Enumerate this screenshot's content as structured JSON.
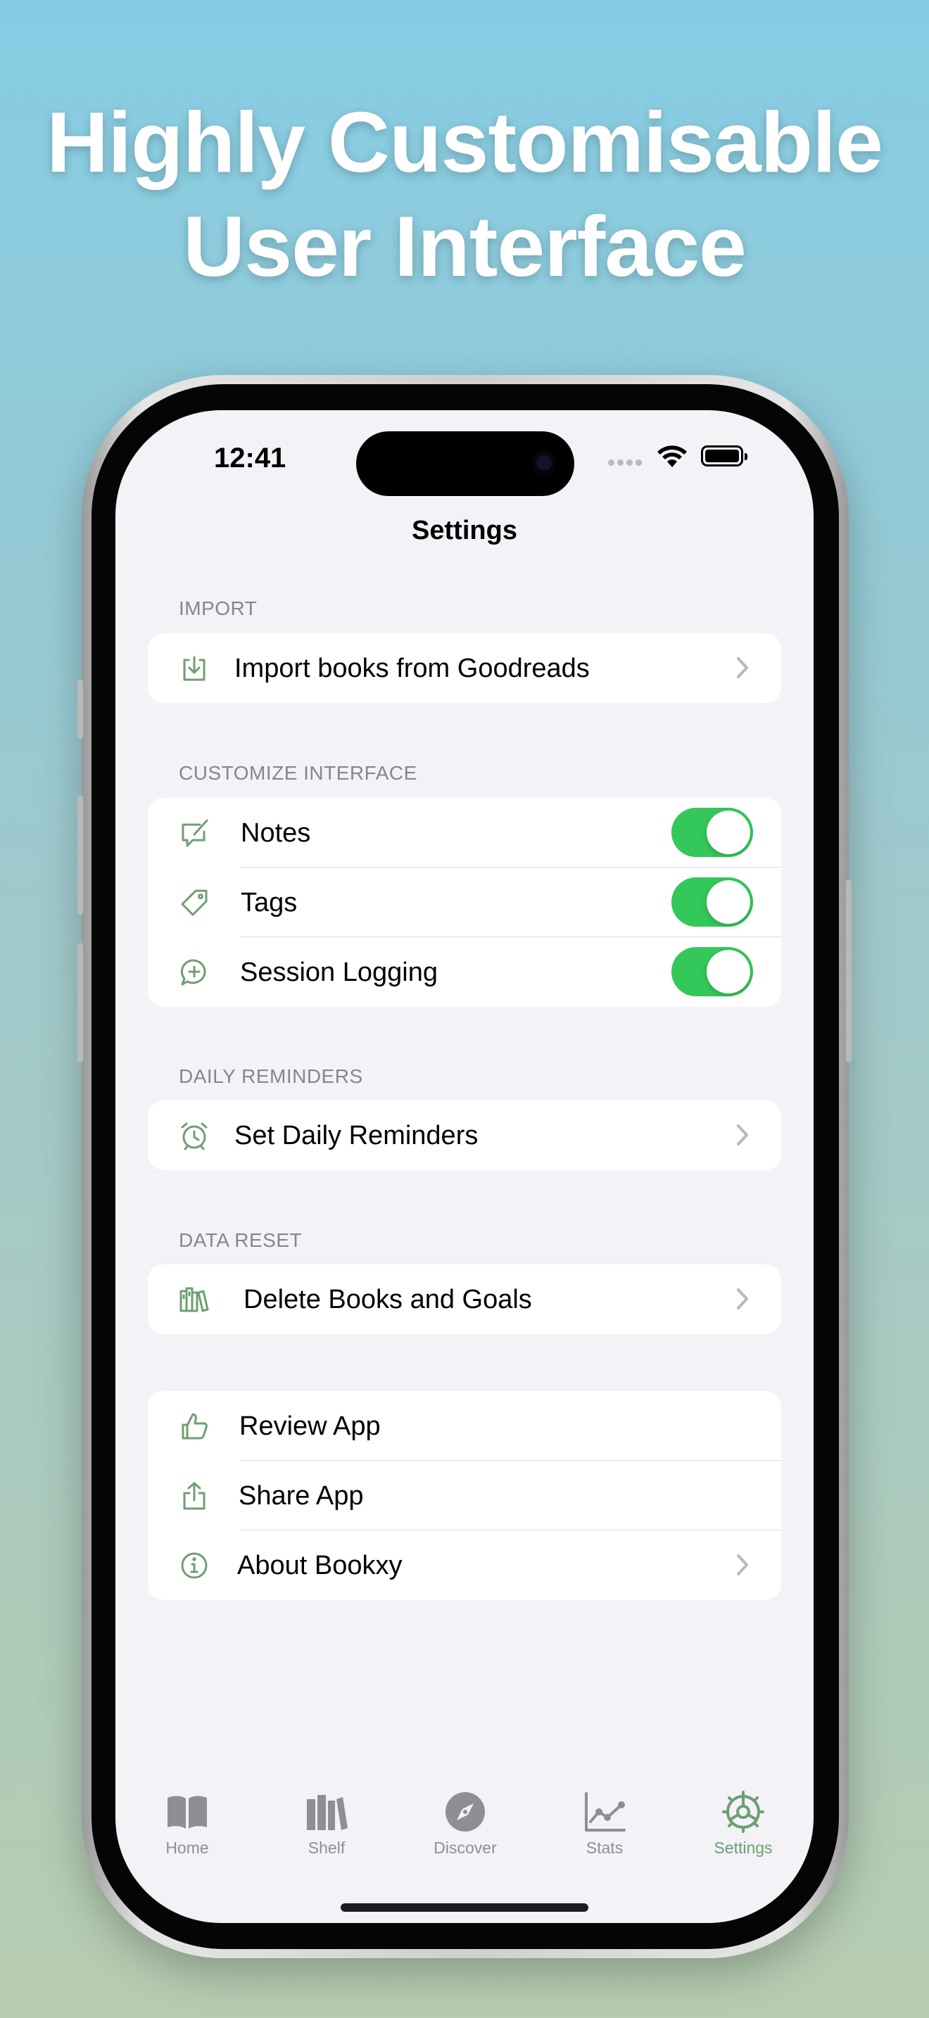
{
  "headline": {
    "line1": "Highly Customisable",
    "line2": "User Interface"
  },
  "status_bar": {
    "time": "12:41"
  },
  "nav": {
    "title": "Settings"
  },
  "colors": {
    "accent": "#6f9e72",
    "toggle_on": "#34c759",
    "background": "#f2f2f7"
  },
  "sections": {
    "import": {
      "header": "IMPORT",
      "rows": [
        {
          "label": "Import books from Goodreads",
          "icon": "import-icon",
          "chevron": true
        }
      ]
    },
    "customize": {
      "header": "CUSTOMIZE INTERFACE",
      "rows": [
        {
          "label": "Notes",
          "icon": "notes-icon",
          "toggle_on": true
        },
        {
          "label": "Tags",
          "icon": "tag-icon",
          "toggle_on": true
        },
        {
          "label": "Session Logging",
          "icon": "session-log-icon",
          "toggle_on": true
        }
      ]
    },
    "reminders": {
      "header": "DAILY REMINDERS",
      "rows": [
        {
          "label": "Set Daily Reminders",
          "icon": "alarm-clock-icon",
          "chevron": true
        }
      ]
    },
    "reset": {
      "header": "DATA RESET",
      "rows": [
        {
          "label": "Delete Books and Goals",
          "icon": "books-icon",
          "chevron": true
        }
      ]
    },
    "about": {
      "rows": [
        {
          "label": "Review App",
          "icon": "thumbs-up-icon"
        },
        {
          "label": "Share App",
          "icon": "share-icon"
        },
        {
          "label": "About Bookxy",
          "icon": "info-icon",
          "chevron": true
        }
      ]
    }
  },
  "tabbar": {
    "tabs": [
      {
        "label": "Home",
        "icon": "book-open-icon"
      },
      {
        "label": "Shelf",
        "icon": "shelf-icon"
      },
      {
        "label": "Discover",
        "icon": "compass-icon"
      },
      {
        "label": "Stats",
        "icon": "chart-icon"
      },
      {
        "label": "Settings",
        "icon": "gear-icon",
        "active": true
      }
    ]
  }
}
